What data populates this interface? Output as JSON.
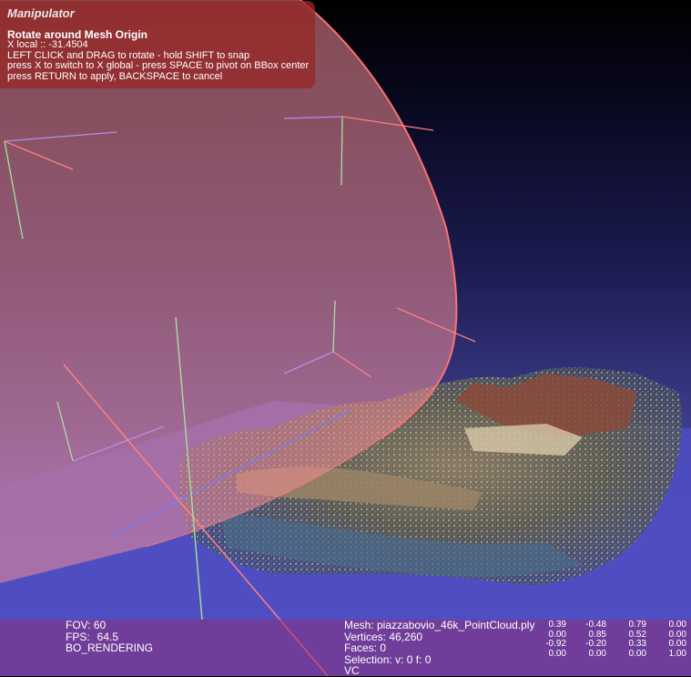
{
  "manipulator": {
    "title": "Manipulator",
    "heading": "Rotate around Mesh Origin",
    "lines": [
      "X local :: -31.4504",
      "LEFT CLICK and DRAG to rotate - hold SHIFT to snap",
      "press X to switch to X global - press SPACE to pivot on BBox center",
      "press RETURN to apply, BACKSPACE to cancel"
    ]
  },
  "render_info": {
    "fov": "FOV: 60",
    "fps_label": "FPS:",
    "fps_value": "64.5",
    "mode": "BO_RENDERING"
  },
  "mesh_info": {
    "mesh": "Mesh: piazzabovio_46k_PointCloud.ply",
    "vertices": "Vertices: 46,260",
    "faces": "Faces: 0",
    "selection": "Selection: v: 0 f: 0",
    "vc": "VC"
  },
  "matrix": [
    [
      "0.39",
      "-0.48",
      "0.79",
      "0.00"
    ],
    [
      "0.00",
      "0.85",
      "0.52",
      "0.00"
    ],
    [
      "-0.92",
      "-0.20",
      "0.33",
      "0.00"
    ],
    [
      "0.00",
      "0.00",
      "0.00",
      "1.00"
    ]
  ],
  "colors": {
    "manipulator_panel": "#962828",
    "rotation_sphere": "#f07070",
    "ground_plane": "#5050b0",
    "status_bar": "#8c3278"
  },
  "icons": {
    "axis_gizmo": "trihedron-icon"
  }
}
